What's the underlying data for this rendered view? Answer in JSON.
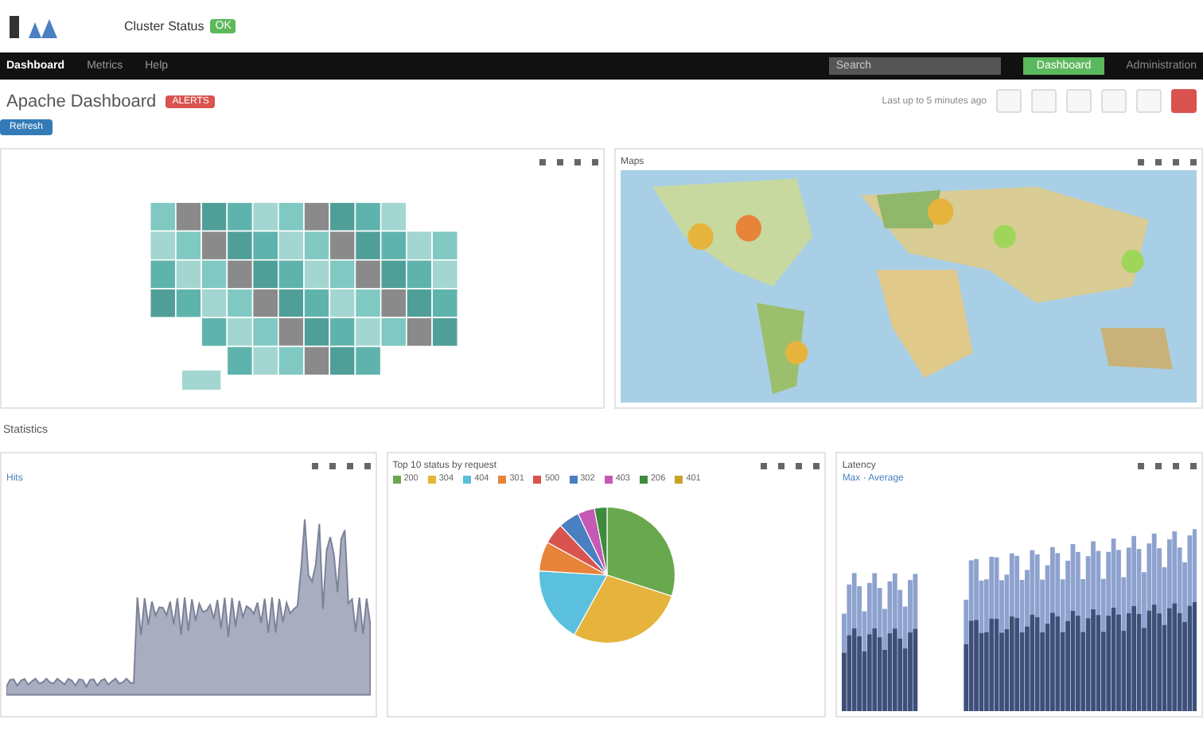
{
  "header": {
    "status_label": "Cluster Status",
    "status_badge": "OK"
  },
  "nav": {
    "items": [
      {
        "label": "Dashboard",
        "selected": true
      },
      {
        "label": "Metrics",
        "selected": false
      },
      {
        "label": "Help",
        "selected": false
      }
    ],
    "search": {
      "placeholder": "Search"
    },
    "primary_button": "Dashboard",
    "right_link": "Administration"
  },
  "page": {
    "title": "Apache Dashboard",
    "badge": "ALERTS",
    "action_button": "Refresh",
    "range_text": "Last up to 5 minutes ago"
  },
  "top_panels": [
    {
      "kind": "choropleth"
    },
    {
      "kind": "map",
      "title": "Maps"
    }
  ],
  "section_title": "Statistics",
  "bottom_panels": [
    {
      "kind": "area",
      "legend": "Hits"
    },
    {
      "kind": "pie",
      "title": "Top 10 status by request",
      "legend": [
        "200",
        "304",
        "404",
        "301",
        "500",
        "302",
        "403",
        "206",
        "401"
      ]
    },
    {
      "kind": "bars",
      "title": "Latency",
      "legend": "Max · Average"
    }
  ]
}
